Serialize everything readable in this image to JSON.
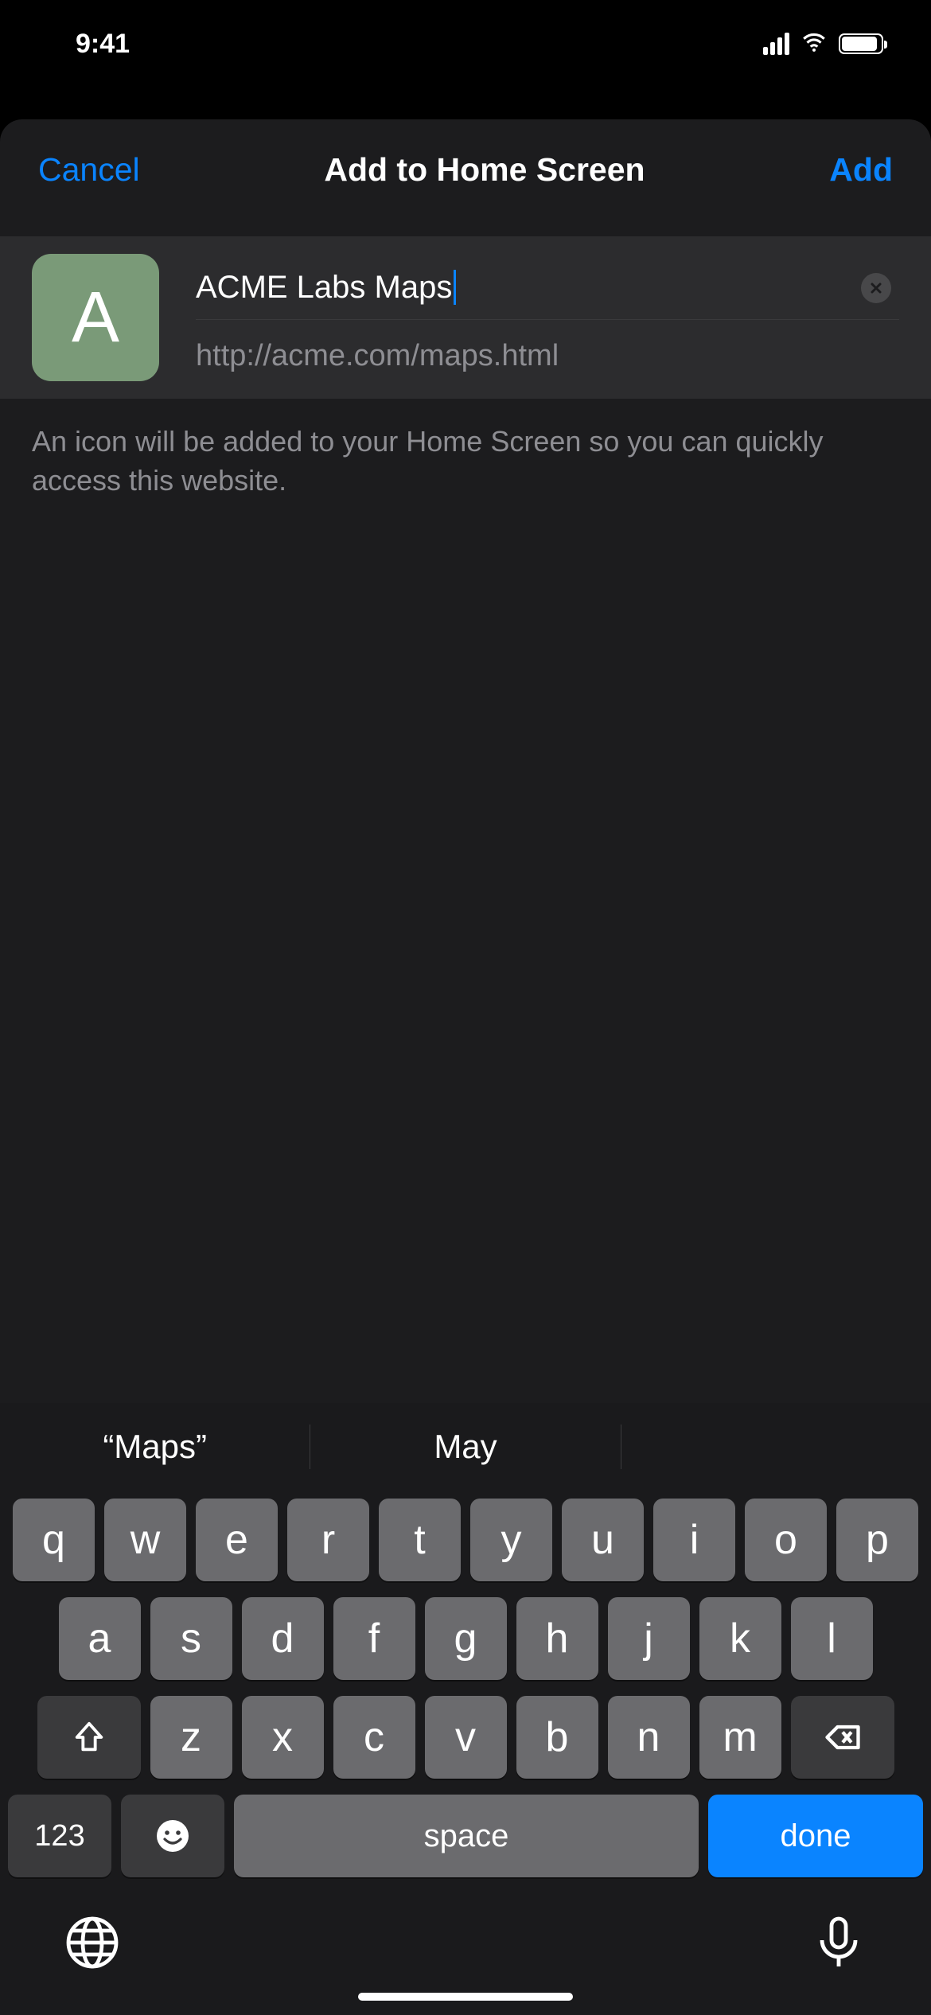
{
  "status": {
    "time": "9:41"
  },
  "nav": {
    "cancel": "Cancel",
    "title": "Add to Home Screen",
    "add": "Add"
  },
  "form": {
    "icon_letter": "A",
    "title_value": "ACME Labs Maps",
    "url": "http://acme.com/maps.html"
  },
  "hint": "An icon will be added to your Home Screen so you can quickly access this website.",
  "keyboard": {
    "suggestions": [
      "“Maps”",
      "May",
      ""
    ],
    "row1": [
      "q",
      "w",
      "e",
      "r",
      "t",
      "y",
      "u",
      "i",
      "o",
      "p"
    ],
    "row2": [
      "a",
      "s",
      "d",
      "f",
      "g",
      "h",
      "j",
      "k",
      "l"
    ],
    "row3": [
      "z",
      "x",
      "c",
      "v",
      "b",
      "n",
      "m"
    ],
    "nums": "123",
    "space": "space",
    "done": "done"
  }
}
